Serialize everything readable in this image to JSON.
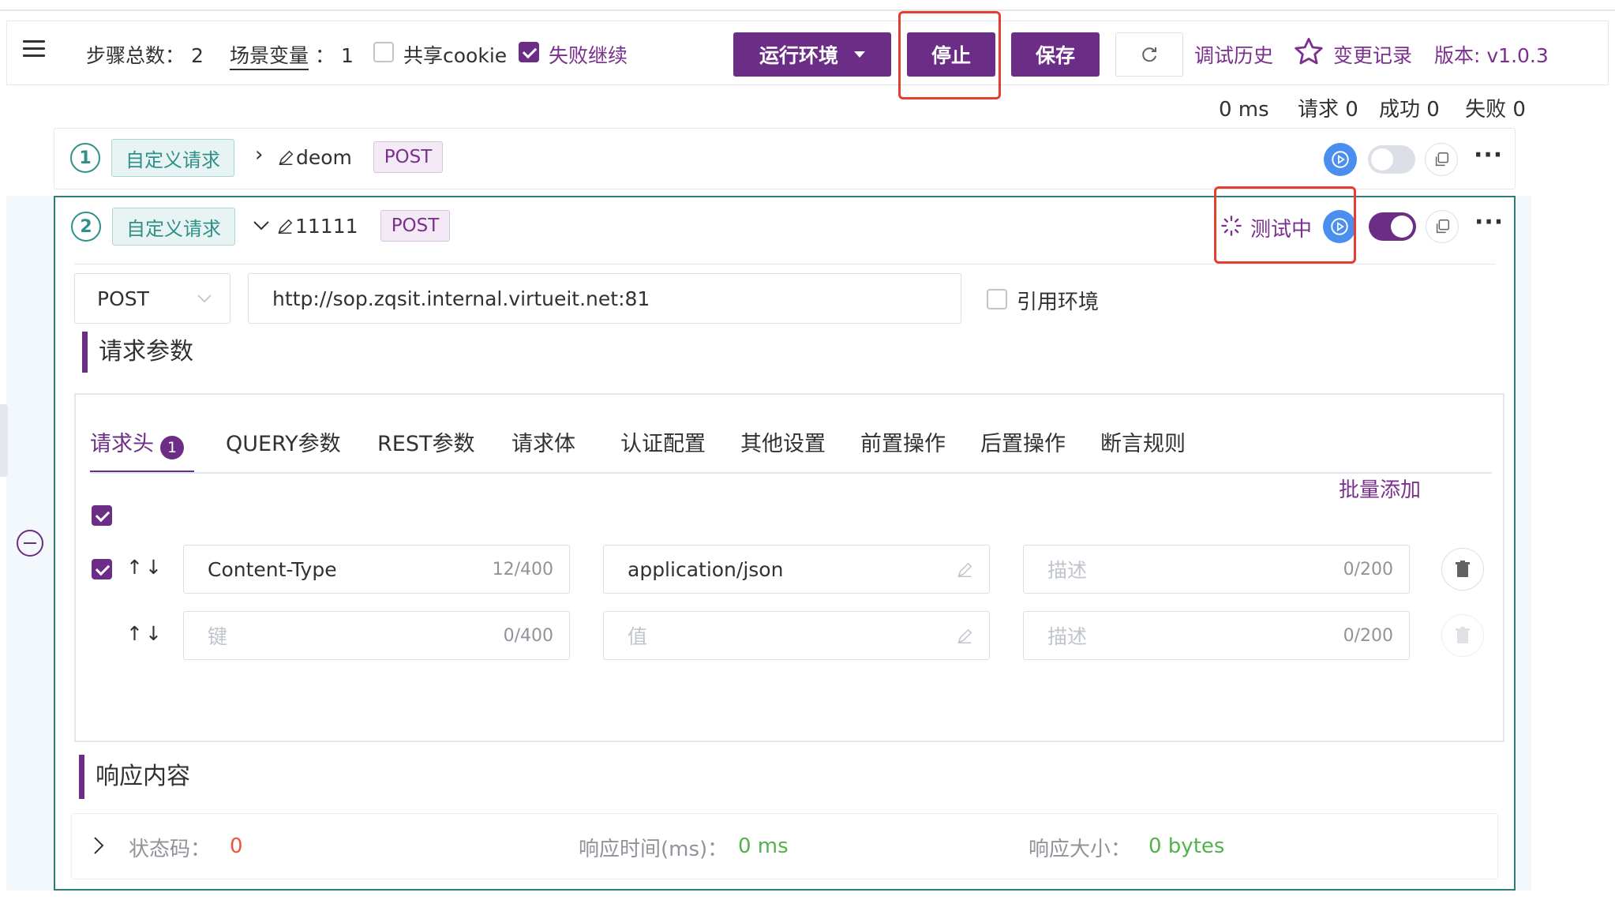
{
  "toolbar": {
    "step_count_label": "步骤总数：",
    "step_count_value": "2",
    "scene_var_label": "场景变量",
    "scene_var_sep": "：",
    "scene_var_value": "1",
    "share_cookie_label": "共享cookie",
    "share_cookie_checked": false,
    "fail_continue_label": "失败继续",
    "fail_continue_checked": true,
    "env_button_label": "运行环境",
    "stop_button_label": "停止",
    "save_button_label": "保存",
    "debug_history_label": "调试历史",
    "change_log_label": "变更记录",
    "version_label": "版本: v1.0.3"
  },
  "stats": {
    "time": "0 ms",
    "requests": "请求 0",
    "success": "成功 0",
    "failed": "失败 0"
  },
  "steps": [
    {
      "index": "1",
      "type": "自定义请求",
      "name": "deom",
      "method": "POST",
      "enabled": false,
      "expanded": false
    },
    {
      "index": "2",
      "type": "自定义请求",
      "name": "11111",
      "method": "POST",
      "enabled": true,
      "expanded": true,
      "status": "测试中"
    }
  ],
  "request": {
    "method": "POST",
    "url": "http://sop.zqsit.internal.virtueit.net:81",
    "use_env_label": "引用环境",
    "use_env_checked": false,
    "params_title": "请求参数",
    "tabs": [
      {
        "label": "请求头",
        "badge": "1"
      },
      {
        "label": "QUERY参数"
      },
      {
        "label": "REST参数"
      },
      {
        "label": "请求体"
      },
      {
        "label": "认证配置"
      },
      {
        "label": "其他设置"
      },
      {
        "label": "前置操作"
      },
      {
        "label": "后置操作"
      },
      {
        "label": "断言规则"
      }
    ],
    "active_tab": "请求头",
    "bulk_add_label": "批量添加",
    "headers": [
      {
        "checked": true,
        "key": "Content-Type",
        "key_count": "12/400",
        "value": "application/json",
        "desc_placeholder": "描述",
        "desc_count": "0/200"
      },
      {
        "checked": false,
        "key_placeholder": "键",
        "key_count": "0/400",
        "value_placeholder": "值",
        "desc_placeholder": "描述",
        "desc_count": "0/200"
      }
    ]
  },
  "response": {
    "title": "响应内容",
    "status_code_label": "状态码：",
    "status_code_value": "0",
    "time_label": "响应时间(ms)：",
    "time_value": "0 ms",
    "size_label": "响应大小：",
    "size_value": "0 bytes"
  },
  "colors": {
    "primary": "#6b2d86",
    "teal": "#2f8f89",
    "highlight_box": "#e53e30",
    "play_blue": "#4a8ff0",
    "success_green": "#52b34a",
    "error_red": "#f0533e"
  }
}
